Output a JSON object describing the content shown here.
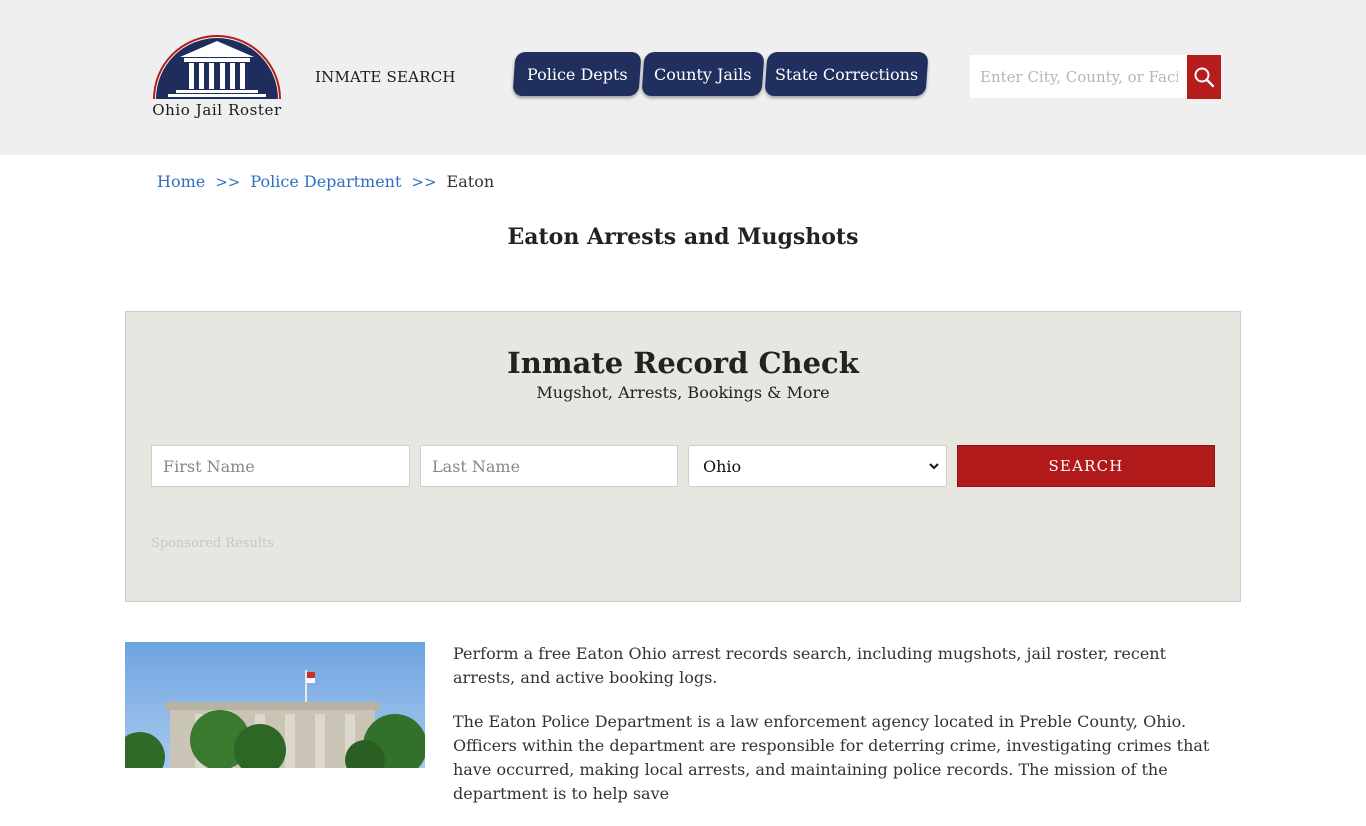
{
  "header": {
    "logo_text": "Ohio Jail Roster",
    "inmate_search_label": "INMATE SEARCH",
    "nav": [
      {
        "label": "Police Depts"
      },
      {
        "label": "County Jails"
      },
      {
        "label": "State Corrections"
      }
    ],
    "search_placeholder": "Enter City, County, or Facility",
    "colors": {
      "background": "#efefef",
      "nav": "#212f5e",
      "accent": "#b51c1c"
    }
  },
  "breadcrumb": {
    "items": [
      {
        "label": "Home"
      },
      {
        "label": "Police Department"
      }
    ],
    "separator": ">>",
    "current": "Eaton"
  },
  "page_title": "Eaton Arrests and Mugshots",
  "record_check": {
    "title": "Inmate Record Check",
    "subtitle": "Mugshot, Arrests, Bookings & More",
    "first_name_placeholder": "First Name",
    "last_name_placeholder": "Last Name",
    "state_value": "Ohio",
    "search_label": "SEARCH",
    "sponsored_label": "Sponsored Results"
  },
  "content": {
    "paragraphs": [
      "Perform a free Eaton Ohio arrest records search, including mugshots, jail roster, recent arrests, and active booking logs.",
      "The Eaton Police Department is a law enforcement agency located in Preble County, Ohio. Officers within the department are responsible for deterring crime, investigating crimes that have occurred, making local arrests, and maintaining police records. The mission of the department is to help save"
    ]
  }
}
